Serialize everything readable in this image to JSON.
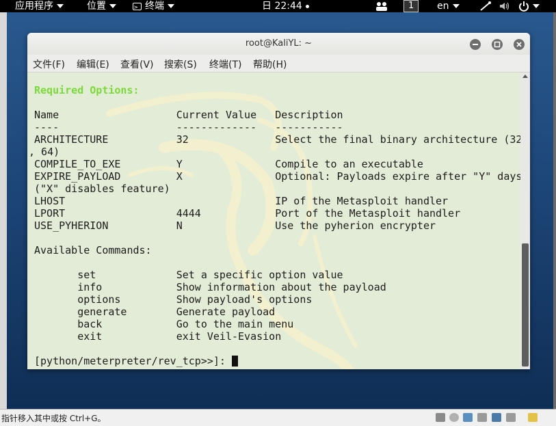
{
  "top_panel": {
    "apps": "应用程序",
    "places": "位置",
    "terminal": "终端",
    "clock": "日 22:44",
    "workspace": "1",
    "language": "en"
  },
  "window": {
    "title": "root@KaliYL: ~",
    "menus": [
      "文件(F)",
      "编辑(E)",
      "查看(V)",
      "搜索(S)",
      "终端(T)",
      "帮助(H)"
    ]
  },
  "terminal": {
    "lines": [
      "Required Options:",
      "",
      "Name                   Current Value   Description",
      "----                   -------------   -----------",
      "ARCHITECTURE           32              Select the final binary architecture (32",
      ", 64)",
      "COMPILE_TO_EXE         Y               Compile to an executable",
      "EXPIRE_PAYLOAD         X               Optional: Payloads expire after \"Y\" days",
      "(\"X\" disables feature)",
      "LHOST                                  IP of the Metasploit handler",
      "LPORT                  4444            Port of the Metasploit handler",
      "USE_PYHERION           N               Use the pyherion encrypter",
      "",
      "Available Commands:",
      "",
      "       set             Set a specific option value",
      "       info            Show information about the payload",
      "       options         Show payload's options",
      "       generate        Generate payload",
      "       back            Go to the main menu",
      "       exit            exit Veil-Evasion",
      "",
      "[python/meterpreter/rev_tcp>>]: "
    ]
  },
  "statusbar": {
    "text": "指针移入其中或按 Ctrl+G。"
  },
  "colors": {
    "terminal_bg": "#e3ecd6",
    "heading_green": "#7bd93a",
    "desktop_blue": "#1d4678"
  }
}
